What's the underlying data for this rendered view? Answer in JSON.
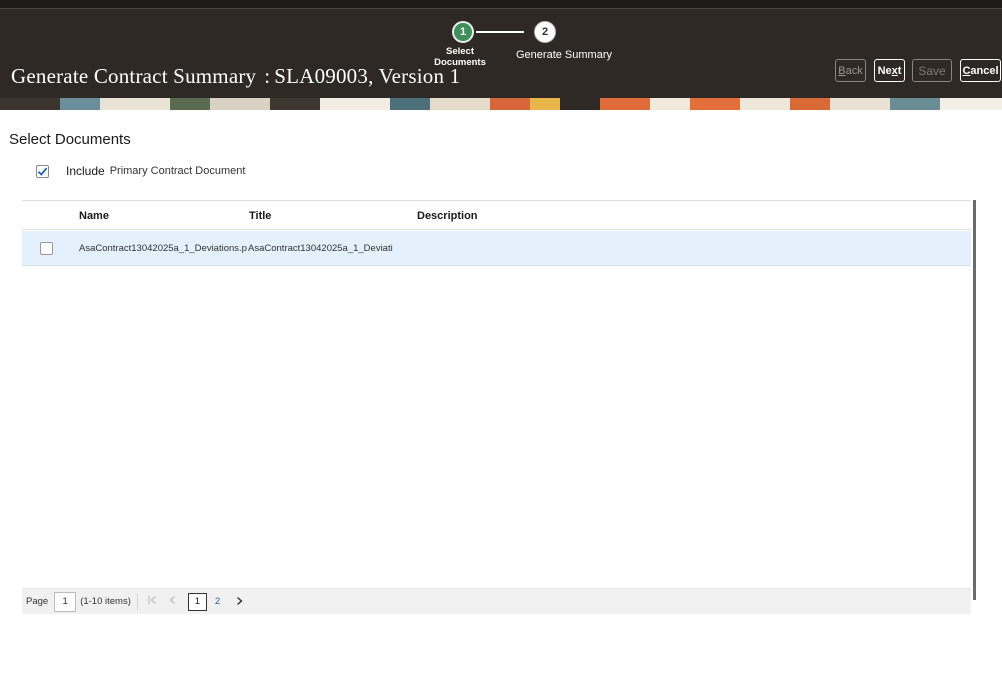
{
  "header": {
    "title": "Generate Contract Summary",
    "title_separator": ":",
    "title_suffix": "SLA09003, Version 1",
    "train": {
      "steps": [
        {
          "number": "1",
          "label": "Select Documents",
          "state": "current"
        },
        {
          "number": "2",
          "label": "Generate Summary",
          "state": "upcoming"
        }
      ]
    },
    "buttons": {
      "back_pre": "",
      "back_mnemonic": "B",
      "back_post": "ack",
      "next_pre": "Ne",
      "next_mnemonic": "x",
      "next_post": "t",
      "save": "Save",
      "cancel_pre": "",
      "cancel_mnemonic": "C",
      "cancel_post": "ancel"
    },
    "colors": {
      "bar": "#2e2925",
      "step_current": "#3f8f5b"
    }
  },
  "main": {
    "section_title": "Select Documents",
    "include": {
      "checked": true,
      "label": "Include",
      "sublabel": "Primary Contract Document"
    },
    "table": {
      "columns": [
        "Name",
        "Title",
        "Description"
      ],
      "rows": [
        {
          "checked": false,
          "name": "AsaContract13042025a_1_Deviations.p",
          "title": "AsaContract13042025a_1_Deviati",
          "description": ""
        }
      ]
    },
    "pagination": {
      "page_label": "Page",
      "current_page": "1",
      "range": "(1-10 items)",
      "pages": [
        "1",
        "2"
      ]
    }
  }
}
